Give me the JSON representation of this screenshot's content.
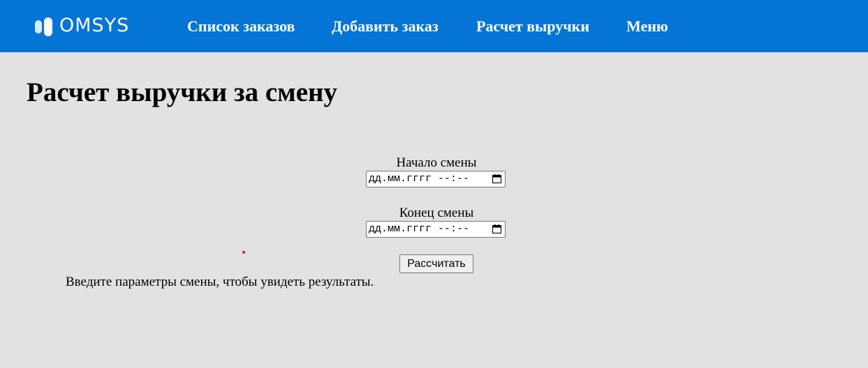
{
  "header": {
    "logo_text": "OMSYS",
    "background_color": "#0575d5",
    "nav": [
      {
        "label": "Список заказов"
      },
      {
        "label": "Добавить заказ"
      },
      {
        "label": "Расчет выручки"
      },
      {
        "label": "Меню"
      }
    ]
  },
  "page": {
    "title": "Расчет выручки за смену",
    "background_color": "#e2e2e2"
  },
  "form": {
    "start": {
      "label": "Начало смены",
      "placeholder": "дд.мм.гггг --:--"
    },
    "end": {
      "label": "Конец смены",
      "placeholder": "дд.мм.гггг --:--"
    },
    "submit_label": "Рассчитать"
  },
  "result": {
    "message": "Введите параметры смены, чтобы увидеть результаты."
  },
  "icons": {
    "calendar": "calendar-icon",
    "logo": "omsys-logo-icon"
  }
}
